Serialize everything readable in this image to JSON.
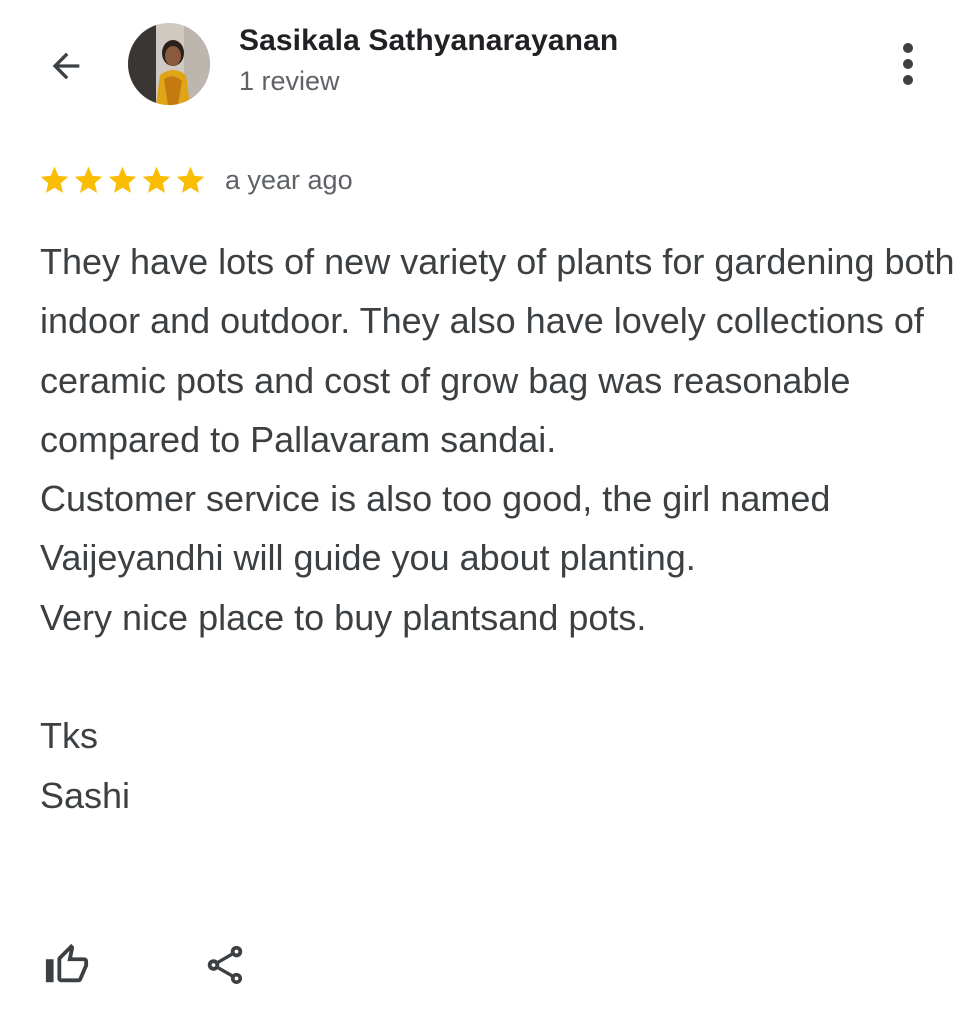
{
  "header": {
    "back_icon": "arrow-back-icon",
    "author_name": "Sasikala Sathyanarayanan",
    "review_count": "1 review",
    "more_icon": "more-vert-icon"
  },
  "review": {
    "rating": 5,
    "rating_max": 5,
    "date": "a year ago",
    "text": [
      "They have lots of new variety of plants for gardening both indoor and outdoor. They also have lovely collections of ceramic pots and cost of grow bag was reasonable compared to Pallavaram sandai.",
      "Customer service is also too good, the girl named Vaijeyandhi will guide you about planting.",
      "Very nice place to buy plantsand pots.",
      "",
      "Tks",
      "Sashi"
    ]
  },
  "actions": {
    "like_icon": "thumb-up-icon",
    "share_icon": "share-icon"
  },
  "colors": {
    "star": "#fbbc04",
    "text": "#3c4043",
    "secondary": "#5f6368",
    "name": "#202124"
  }
}
